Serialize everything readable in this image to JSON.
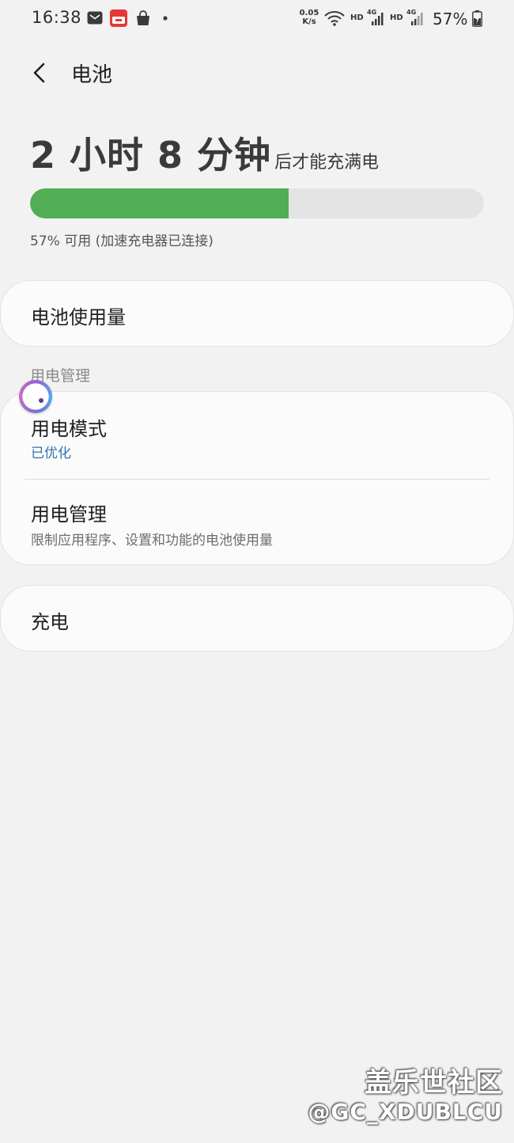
{
  "status_bar": {
    "time": "16:38",
    "net_speed_value": "0.05",
    "net_speed_unit": "K/s",
    "hd_1": "HD",
    "net_1": "4G",
    "hd_2": "HD",
    "net_2": "4G",
    "battery_percent": "57%"
  },
  "header": {
    "title": "电池"
  },
  "charge": {
    "time_remaining": "2 小时 8 分钟",
    "suffix": "后才能充满电",
    "level_percent": 57,
    "status_text": "57% 可用 (加速充电器已连接)"
  },
  "battery_usage": {
    "title": "电池使用量"
  },
  "power_section": {
    "header": "用电管理",
    "mode_title": "用电模式",
    "mode_value": "已优化",
    "manage_title": "用电管理",
    "manage_desc": "限制应用程序、设置和功能的电池使用量"
  },
  "charging": {
    "title": "充电"
  },
  "watermark": {
    "line1": "盖乐世社区",
    "line2": "@GC_XDUBLCU"
  },
  "colors": {
    "background": "#f2f2f2",
    "progress_fill": "#52ae55",
    "accent_text": "#2c72b3"
  }
}
